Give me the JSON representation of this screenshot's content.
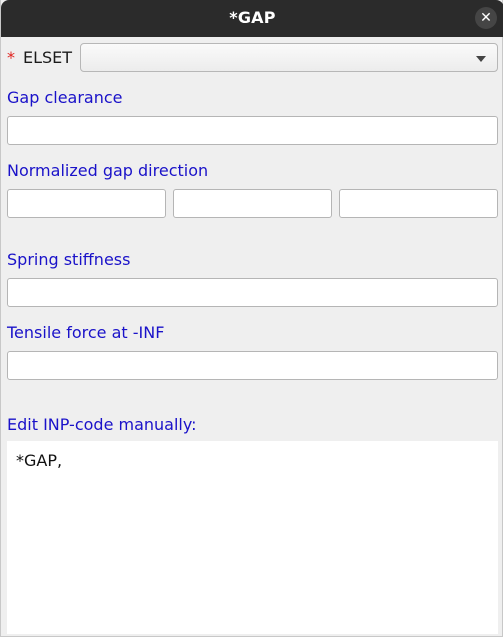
{
  "window": {
    "title": "*GAP",
    "close_icon": "close-icon",
    "close_glyph": "✕"
  },
  "elset": {
    "required_marker": "*",
    "label": "ELSET",
    "selected_value": "",
    "dropdown_icon": "chevron-down-icon"
  },
  "gap_clearance": {
    "label": "Gap clearance",
    "value": ""
  },
  "gap_direction": {
    "label": "Normalized gap direction",
    "x_value": "",
    "y_value": "",
    "z_value": ""
  },
  "spring_stiffness": {
    "label": "Spring stiffness",
    "value": ""
  },
  "tensile_force": {
    "label": "Tensile force at -INF",
    "value": ""
  },
  "inp_code": {
    "label": "Edit INP-code manually:",
    "value": "*GAP,"
  },
  "colors": {
    "title_bar": "#2b2b2b",
    "label_blue": "#1a12c9",
    "required_red": "#e0201c",
    "background": "#efefef"
  }
}
